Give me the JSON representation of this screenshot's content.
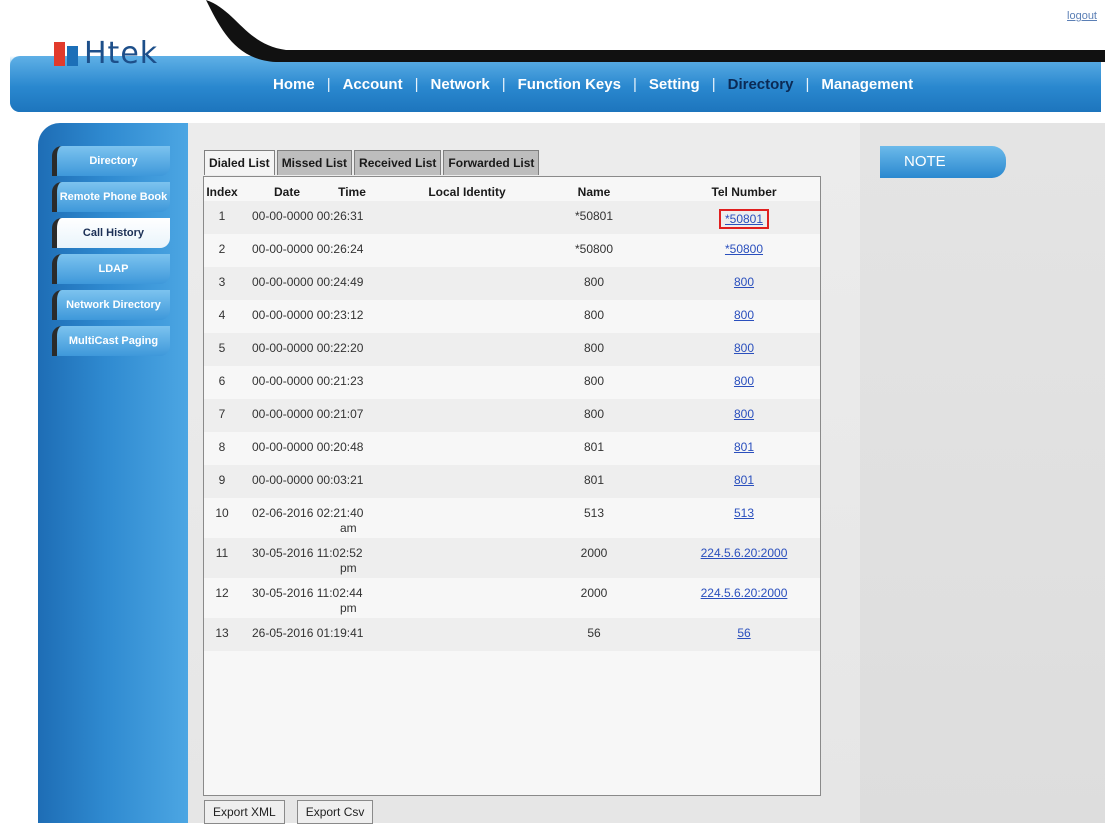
{
  "header": {
    "brand": "Htek",
    "logout_label": "logout",
    "nav": [
      {
        "label": "Home"
      },
      {
        "label": "Account"
      },
      {
        "label": "Network"
      },
      {
        "label": "Function Keys"
      },
      {
        "label": "Setting"
      },
      {
        "label": "Directory",
        "active": true
      },
      {
        "label": "Management"
      }
    ]
  },
  "sidebar": {
    "items": [
      {
        "label": "Directory"
      },
      {
        "label": "Remote Phone Book"
      },
      {
        "label": "Call History",
        "active": true
      },
      {
        "label": "LDAP"
      },
      {
        "label": "Network Directory"
      },
      {
        "label": "MultiCast Paging"
      }
    ]
  },
  "tabs": [
    {
      "label": "Dialed List",
      "active": true
    },
    {
      "label": "Missed List"
    },
    {
      "label": "Received List"
    },
    {
      "label": "Forwarded List"
    }
  ],
  "table": {
    "headers": [
      "Index",
      "Date",
      "Time",
      "Local Identity",
      "Name",
      "Tel Number"
    ],
    "rows": [
      {
        "index": "1",
        "date": "00-00-0000",
        "time": "00:26:31",
        "suffix": "",
        "local": "",
        "name": "*50801",
        "tel": "*50801",
        "highlight": true
      },
      {
        "index": "2",
        "date": "00-00-0000",
        "time": "00:26:24",
        "suffix": "",
        "local": "",
        "name": "*50800",
        "tel": "*50800"
      },
      {
        "index": "3",
        "date": "00-00-0000",
        "time": "00:24:49",
        "suffix": "",
        "local": "",
        "name": "800",
        "tel": "800"
      },
      {
        "index": "4",
        "date": "00-00-0000",
        "time": "00:23:12",
        "suffix": "",
        "local": "",
        "name": "800",
        "tel": "800"
      },
      {
        "index": "5",
        "date": "00-00-0000",
        "time": "00:22:20",
        "suffix": "",
        "local": "",
        "name": "800",
        "tel": "800"
      },
      {
        "index": "6",
        "date": "00-00-0000",
        "time": "00:21:23",
        "suffix": "",
        "local": "",
        "name": "800",
        "tel": "800"
      },
      {
        "index": "7",
        "date": "00-00-0000",
        "time": "00:21:07",
        "suffix": "",
        "local": "",
        "name": "800",
        "tel": "800"
      },
      {
        "index": "8",
        "date": "00-00-0000",
        "time": "00:20:48",
        "suffix": "",
        "local": "",
        "name": "801",
        "tel": "801"
      },
      {
        "index": "9",
        "date": "00-00-0000",
        "time": "00:03:21",
        "suffix": "",
        "local": "",
        "name": "801",
        "tel": "801"
      },
      {
        "index": "10",
        "date": "02-06-2016",
        "time": "02:21:40",
        "suffix": "am",
        "local": "",
        "name": "513",
        "tel": "513"
      },
      {
        "index": "11",
        "date": "30-05-2016",
        "time": "11:02:52",
        "suffix": "pm",
        "local": "",
        "name": "2000",
        "tel": "224.5.6.20:2000"
      },
      {
        "index": "12",
        "date": "30-05-2016",
        "time": "11:02:44",
        "suffix": "pm",
        "local": "",
        "name": "2000",
        "tel": "224.5.6.20:2000"
      },
      {
        "index": "13",
        "date": "26-05-2016",
        "time": "01:19:41",
        "suffix": "",
        "local": "",
        "name": "56",
        "tel": "56"
      }
    ]
  },
  "note": {
    "title": "NOTE"
  },
  "actions": {
    "export_xml": "Export XML",
    "export_csv": "Export Csv"
  },
  "colors": {
    "header_blue": "#2a88cf",
    "link_blue": "#2a4fbd",
    "highlight_red": "#e02020"
  }
}
